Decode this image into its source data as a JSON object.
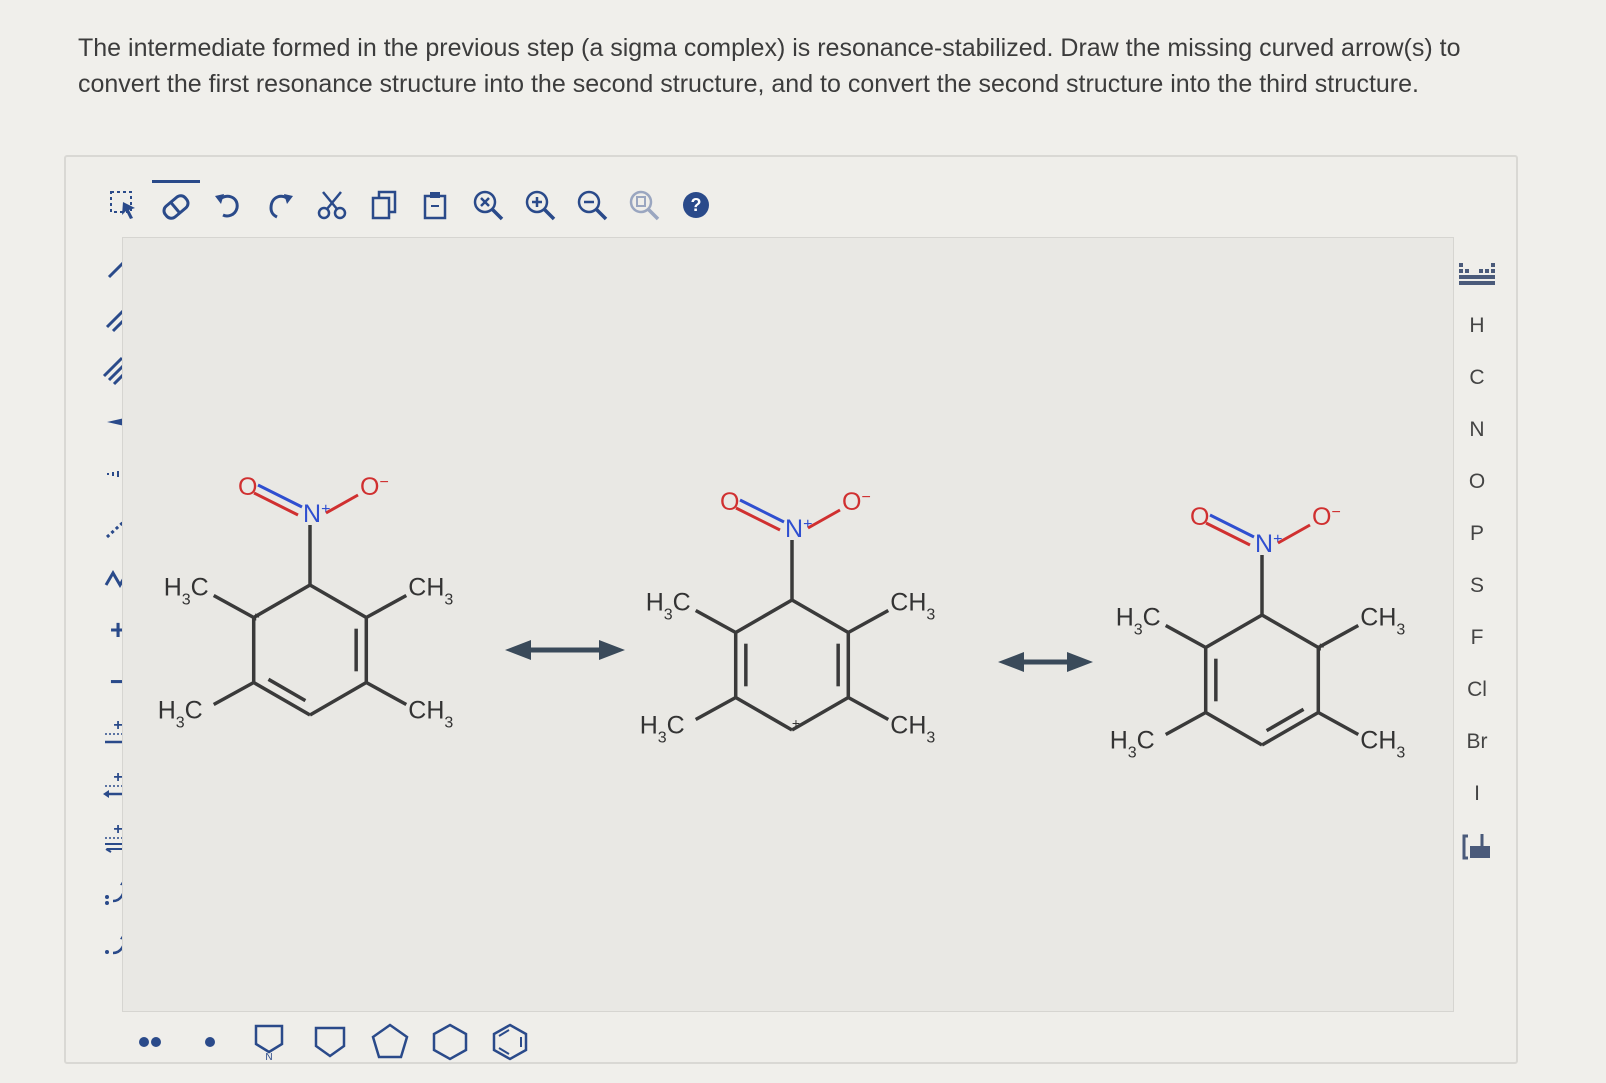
{
  "prompt": {
    "line1": "The intermediate formed in the previous step (a sigma complex) is resonance-stabilized. Draw the missing curved arrow(s) to",
    "line2": "convert the first resonance structure into the second structure, and to convert the second structure into the third structure."
  },
  "toolbar_top": [
    "select-icon",
    "eraser-icon",
    "undo-icon",
    "redo-icon",
    "cut-icon",
    "copy-icon",
    "paste-icon",
    "zoom-reset-icon",
    "zoom-in-icon",
    "zoom-out-icon",
    "clean-icon",
    "help-icon"
  ],
  "left_tools": [
    "single-bond",
    "double-bond",
    "triple-bond",
    "wedge-bond",
    "hash-bond",
    "dashed-bond",
    "chain-tool",
    "positive-charge",
    "negative-charge",
    "reaction-arrow",
    "resonance-arrow",
    "equilibrium-arrow",
    "electron-pair-arrow",
    "single-electron-arrow"
  ],
  "left_labels": {
    "plus": "+",
    "minus": "−"
  },
  "elements": [
    "H",
    "C",
    "N",
    "O",
    "P",
    "S",
    "F",
    "Cl",
    "Br",
    "I"
  ],
  "bottom_tools": [
    "lone-pair",
    "radical",
    "cyclopropane",
    "cyclobutane",
    "cyclopentane",
    "cyclohexane",
    "benzene"
  ],
  "molecule": {
    "o_label": "O",
    "o_minus_label": "O",
    "minus_sup": "−",
    "n_label": "N",
    "plus_sup": "+",
    "ring_plus": "+",
    "h3c_top": "H",
    "h3c_bottom": "H",
    "ch3_top": "CH",
    "ch3_bottom": "CH",
    "sub3": "3",
    "c_suffix": "C"
  },
  "colors": {
    "oxygen": "#d03030",
    "nitrogen": "#2f4fd0",
    "bond": "#3a3a3a",
    "accent": "#2a4a8a"
  }
}
